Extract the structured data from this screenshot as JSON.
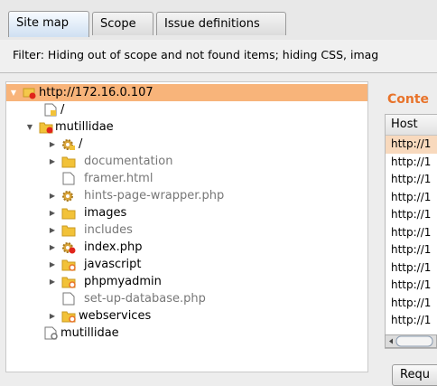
{
  "tabs": [
    {
      "label": "Site map",
      "active": true
    },
    {
      "label": "Scope",
      "active": false
    },
    {
      "label": "Issue definitions",
      "active": false
    }
  ],
  "filter": {
    "text": "Filter: Hiding out of scope and not found items;  hiding CSS, imag"
  },
  "tree": {
    "items": [
      {
        "label": "http://172.16.0.107",
        "icon": "host-error-icon",
        "toggle": "expanded",
        "selected": true,
        "grey": false
      },
      {
        "label": "/",
        "icon": "file-icon",
        "toggle": "",
        "grey": false
      },
      {
        "label": "mutillidae",
        "icon": "folder-error-icon",
        "toggle": "expanded",
        "grey": false
      },
      {
        "label": "/",
        "icon": "gear-icon",
        "toggle": "collapsed",
        "grey": false
      },
      {
        "label": "documentation",
        "icon": "folder-icon",
        "toggle": "collapsed",
        "grey": true
      },
      {
        "label": "framer.html",
        "icon": "file-icon",
        "toggle": "",
        "grey": true
      },
      {
        "label": "hints-page-wrapper.php",
        "icon": "gear-icon",
        "toggle": "collapsed",
        "grey": true
      },
      {
        "label": "images",
        "icon": "folder-icon",
        "toggle": "collapsed",
        "grey": false
      },
      {
        "label": "includes",
        "icon": "folder-icon",
        "toggle": "collapsed",
        "grey": true
      },
      {
        "label": "index.php",
        "icon": "gear-error-icon",
        "toggle": "collapsed",
        "grey": false
      },
      {
        "label": "javascript",
        "icon": "folder-info-icon",
        "toggle": "collapsed",
        "grey": false
      },
      {
        "label": "phpmyadmin",
        "icon": "folder-info-icon",
        "toggle": "collapsed",
        "grey": false
      },
      {
        "label": "set-up-database.php",
        "icon": "file-icon",
        "toggle": "",
        "grey": true
      },
      {
        "label": "webservices",
        "icon": "folder-info-icon",
        "toggle": "collapsed",
        "grey": false
      },
      {
        "label": "mutillidae",
        "icon": "file-info-icon",
        "toggle": "",
        "grey": false
      }
    ]
  },
  "contents": {
    "title": "Conte",
    "column_host": "Host",
    "rows": [
      "http://1",
      "http://1",
      "http://1",
      "http://1",
      "http://1",
      "http://1",
      "http://1",
      "http://1",
      "http://1",
      "http://1",
      "http://1"
    ]
  },
  "request_button": {
    "label": "Requ"
  },
  "colors": {
    "accent": "#e8732a",
    "selection": "#f8b47a",
    "error_dot": "#e0251b",
    "folder": "#f2c238"
  }
}
